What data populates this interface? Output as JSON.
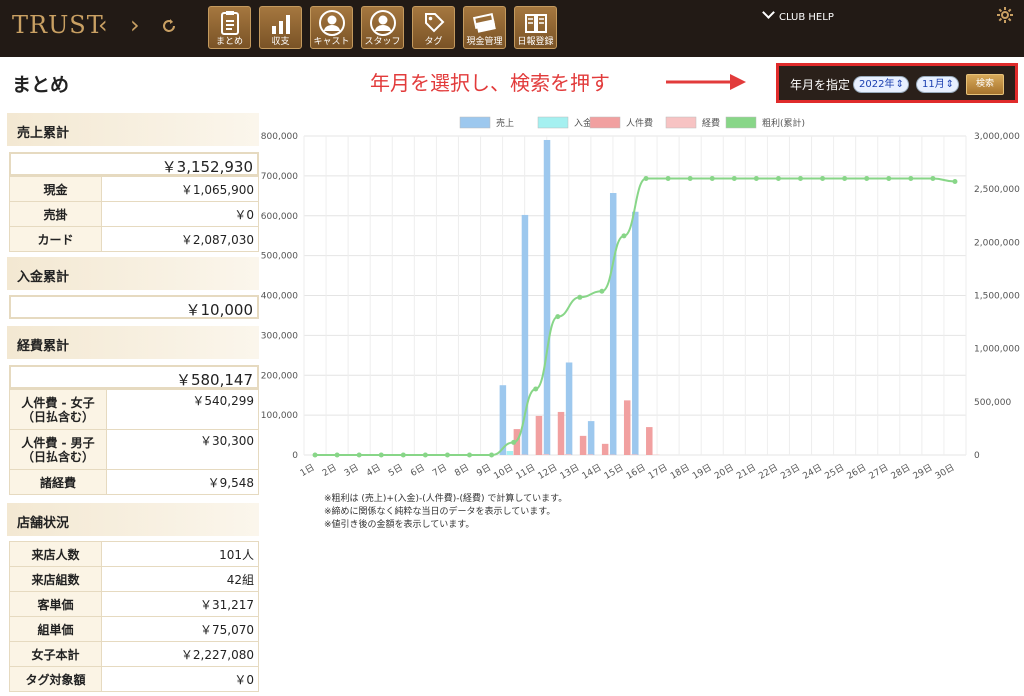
{
  "header": {
    "logo": "TRUST",
    "help_label": "CLUB HELP",
    "tools": [
      {
        "label": "まとめ",
        "icon": "clipboard-icon"
      },
      {
        "label": "収支",
        "icon": "bar-chart-icon"
      },
      {
        "label": "キャスト",
        "icon": "cast-person-icon"
      },
      {
        "label": "スタッフ",
        "icon": "staff-person-icon"
      },
      {
        "label": "タグ",
        "icon": "tag-icon"
      },
      {
        "label": "現金管理",
        "icon": "cash-icon"
      },
      {
        "label": "日報登録",
        "icon": "book-icon"
      }
    ]
  },
  "page": {
    "title": "まとめ",
    "annotation": "年月を選択し、検索を押す"
  },
  "search": {
    "label": "年月を指定",
    "year": "2022年",
    "month": "11月",
    "button": "検索"
  },
  "sales": {
    "title": "売上累計",
    "total": "￥3,152,930",
    "rows": [
      {
        "k": "現金",
        "v": "￥1,065,900"
      },
      {
        "k": "売掛",
        "v": "￥0"
      },
      {
        "k": "カード",
        "v": "￥2,087,030"
      }
    ]
  },
  "deposit": {
    "title": "入金累計",
    "total": "￥10,000"
  },
  "expense": {
    "title": "経費累計",
    "total": "￥580,147",
    "rows": [
      {
        "k": "人件費 - 女子\n（日払含む）",
        "v": "￥540,299"
      },
      {
        "k": "人件費 - 男子\n（日払含む）",
        "v": "￥30,300"
      },
      {
        "k": "諸経費",
        "v": "￥9,548"
      }
    ]
  },
  "store": {
    "title": "店舗状況",
    "rows": [
      {
        "k": "来店人数",
        "v": "101人"
      },
      {
        "k": "来店組数",
        "v": "42組"
      },
      {
        "k": "客単価",
        "v": "￥31,217"
      },
      {
        "k": "組単価",
        "v": "￥75,070"
      },
      {
        "k": "女子本計",
        "v": "￥2,227,080"
      },
      {
        "k": "タグ対象額",
        "v": "￥0"
      }
    ]
  },
  "notes": [
    "※粗利は (売上)+(入金)-(人件費)-(経費) で計算しています。",
    "※締めに関係なく純粋な当日のデータを表示しています。",
    "※値引き後の金額を表示しています。"
  ],
  "chart_data": {
    "type": "bar",
    "categories": [
      "1日",
      "2日",
      "3日",
      "4日",
      "5日",
      "6日",
      "7日",
      "8日",
      "9日",
      "10日",
      "11日",
      "12日",
      "13日",
      "14日",
      "15日",
      "16日",
      "17日",
      "18日",
      "19日",
      "20日",
      "21日",
      "22日",
      "23日",
      "24日",
      "25日",
      "26日",
      "27日",
      "28日",
      "29日",
      "30日"
    ],
    "series": [
      {
        "name": "売上",
        "color": "#9dc8ee",
        "axis": "left",
        "values": [
          0,
          0,
          0,
          0,
          0,
          0,
          0,
          0,
          0,
          175000,
          602000,
          790000,
          232000,
          85000,
          657000,
          610000,
          0,
          0,
          0,
          0,
          0,
          0,
          0,
          0,
          0,
          0,
          0,
          0,
          0,
          0
        ]
      },
      {
        "name": "入金",
        "color": "#a5f0f0",
        "axis": "left",
        "values": [
          0,
          0,
          0,
          0,
          0,
          0,
          0,
          0,
          0,
          10000,
          0,
          0,
          0,
          0,
          0,
          0,
          0,
          0,
          0,
          0,
          0,
          0,
          0,
          0,
          0,
          0,
          0,
          0,
          0,
          0
        ]
      },
      {
        "name": "人件費",
        "color": "#f1a0a0",
        "axis": "left",
        "values": [
          0,
          0,
          0,
          0,
          0,
          0,
          0,
          0,
          0,
          65000,
          98000,
          108000,
          48000,
          28000,
          137000,
          70000,
          0,
          0,
          0,
          0,
          0,
          0,
          0,
          0,
          0,
          0,
          0,
          0,
          0,
          0
        ]
      },
      {
        "name": "経費",
        "color": "#f7c3c3",
        "axis": "left",
        "values": [
          0,
          0,
          0,
          0,
          0,
          0,
          0,
          0,
          0,
          1000,
          2000,
          2000,
          1500,
          1000,
          1500,
          1000,
          0,
          0,
          0,
          0,
          0,
          0,
          0,
          0,
          0,
          0,
          0,
          0,
          0,
          0
        ]
      },
      {
        "name": "粗利(累計)",
        "type": "line",
        "color": "#88d688",
        "axis": "right",
        "values": [
          0,
          0,
          0,
          0,
          0,
          0,
          0,
          0,
          0,
          119000,
          621000,
          1301000,
          1483000,
          1540000,
          2061000,
          2600000,
          2600000,
          2600000,
          2600000,
          2600000,
          2600000,
          2600000,
          2600000,
          2600000,
          2600000,
          2600000,
          2600000,
          2600000,
          2600000,
          2572000
        ]
      }
    ],
    "ylim": [
      0,
      800000
    ],
    "y2lim": [
      0,
      3000000
    ],
    "yticks": [
      "0",
      "100,000",
      "200,000",
      "300,000",
      "400,000",
      "500,000",
      "600,000",
      "700,000",
      "800,000"
    ],
    "y2ticks": [
      "0",
      "500,000",
      "1,000,000",
      "1,500,000",
      "2,000,000",
      "2,500,000",
      "3,000,000"
    ],
    "legend": "top",
    "grid": true
  }
}
